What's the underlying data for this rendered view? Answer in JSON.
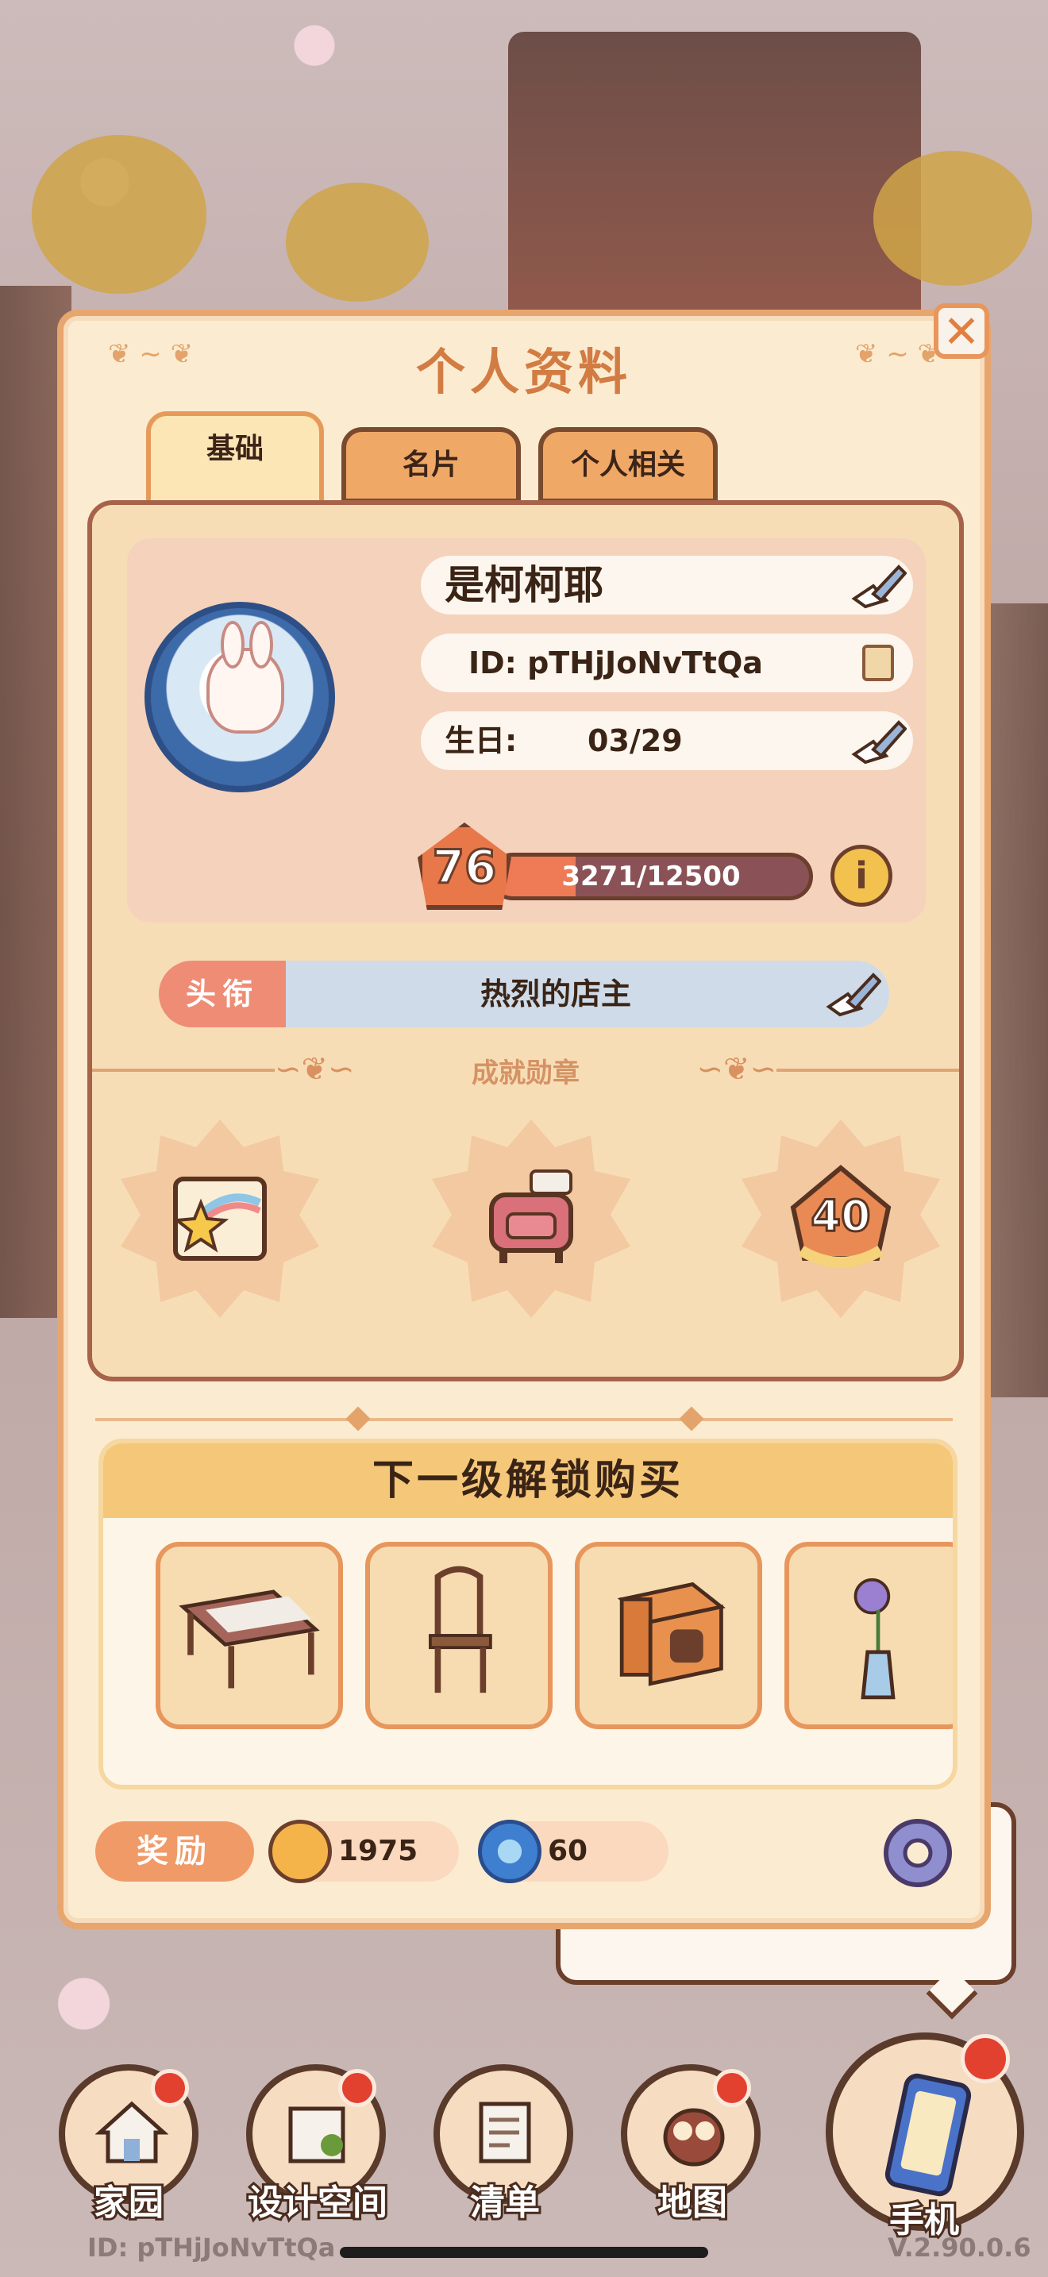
{
  "panel": {
    "title": "个人资料",
    "close_icon": "close-icon"
  },
  "tabs": [
    {
      "label": "基础",
      "active": true
    },
    {
      "label": "名片",
      "active": false
    },
    {
      "label": "个人相关",
      "active": false
    }
  ],
  "profile": {
    "name": "是柯柯耶",
    "id_text": "ID: pTHjJoNvTtQa",
    "birthday_label": "生日:",
    "birthday_value": "03/29",
    "level": "76",
    "xp_text": "3271/12500",
    "xp_fraction": 0.262
  },
  "title_row": {
    "tag": "头衔",
    "value": "热烈的店主"
  },
  "achievements": {
    "heading": "成就勋章",
    "badges": [
      {
        "icon": "rainbow-star-scroll-icon"
      },
      {
        "icon": "armchair-icon"
      },
      {
        "icon": "level-40-badge-icon",
        "text": "40"
      }
    ]
  },
  "unlock": {
    "heading": "下一级解锁购买",
    "items": [
      {
        "icon": "table-icon"
      },
      {
        "icon": "chair-icon"
      },
      {
        "icon": "cabinet-icon"
      },
      {
        "icon": "flower-vase-icon"
      }
    ]
  },
  "rewards": {
    "label": "奖励",
    "items": [
      {
        "icon": "coin-icon",
        "value": "1975"
      },
      {
        "icon": "swirl-gem-icon",
        "value": "60"
      }
    ]
  },
  "nav": [
    {
      "label": "家园",
      "icon": "home-icon"
    },
    {
      "label": "设计空间",
      "icon": "design-icon"
    },
    {
      "label": "清单",
      "icon": "list-icon"
    },
    {
      "label": "地图",
      "icon": "map-owl-icon"
    },
    {
      "label": "手机",
      "icon": "phone-icon"
    }
  ],
  "footer": {
    "id": "ID: pTHjJoNvTtQa",
    "version": "V.2.90.0.6"
  },
  "colors": {
    "accent": "#e8965c",
    "panel_bg": "#fbecd1",
    "xp_fill": "#ef7a56",
    "badge_red": "#e2412f"
  }
}
